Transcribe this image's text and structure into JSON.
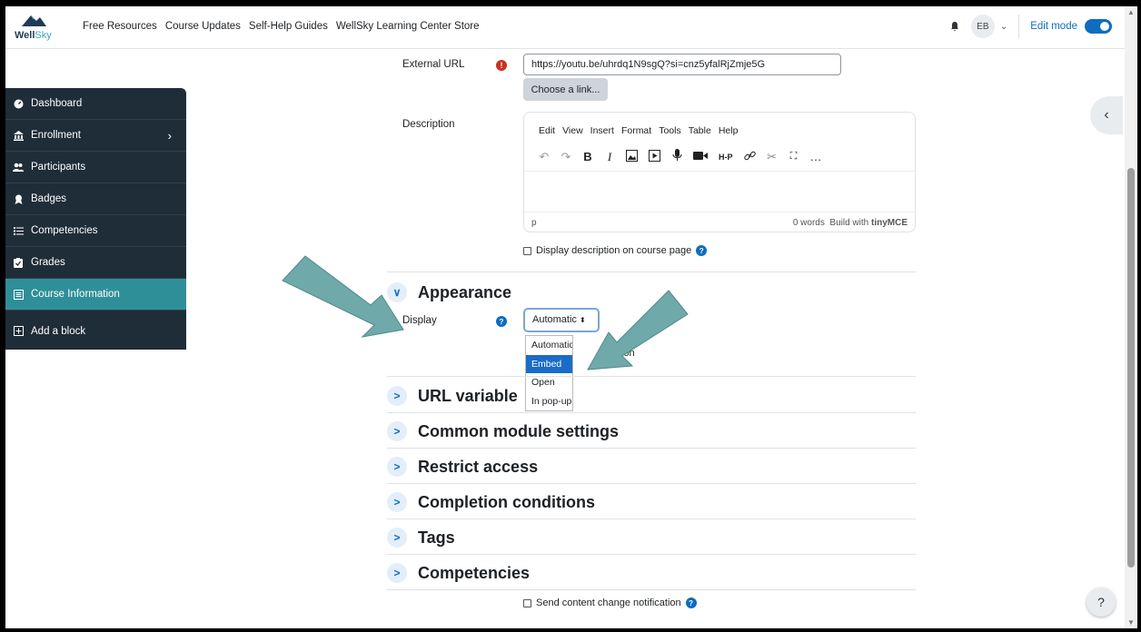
{
  "brand": {
    "name_part1": "Well",
    "name_part2": "Sky"
  },
  "nav": {
    "links": [
      "Free Resources",
      "Course Updates",
      "Self-Help Guides",
      "WellSky Learning Center Store"
    ],
    "user_initials": "EB",
    "edit_mode_label": "Edit mode"
  },
  "drawer": {
    "items": [
      {
        "label": "Dashboard",
        "icon": "dashboard-icon"
      },
      {
        "label": "Enrollment",
        "icon": "bank-icon"
      },
      {
        "label": "Participants",
        "icon": "users-icon"
      },
      {
        "label": "Badges",
        "icon": "badge-icon"
      },
      {
        "label": "Competencies",
        "icon": "list-icon"
      },
      {
        "label": "Grades",
        "icon": "grades-icon"
      },
      {
        "label": "Course Information",
        "icon": "info-box-icon"
      }
    ],
    "add_block": "Add a block"
  },
  "form": {
    "external_url_label": "External URL",
    "external_url_value": "https://youtu.be/uhrdq1N9sgQ?si=cnz5yfalRjZmje5G",
    "choose_link_button": "Choose a link...",
    "description_label": "Description",
    "editor_menus": [
      "Edit",
      "View",
      "Insert",
      "Format",
      "Tools",
      "Table",
      "Help"
    ],
    "editor_status_path": "p",
    "editor_word_count": "0 words",
    "editor_branding": "Build with",
    "editor_brand_name": "tinyMCE",
    "display_description_label": "Display description on course page",
    "appearance_heading": "Appearance",
    "display_label": "Display",
    "display_selected": "Automatic",
    "display_options": [
      "Automatic",
      "Embed",
      "Open",
      "In pop-up"
    ],
    "display_highlighted": "Embed",
    "partial_hidden_text": "ion",
    "sections": [
      "URL variables",
      "Common module settings",
      "Restrict access",
      "Completion conditions",
      "Tags",
      "Competencies"
    ],
    "url_variables_visible": "URL variable",
    "send_notification_label": "Send content change notification"
  },
  "colors": {
    "drawer_bg": "#1f2d39",
    "drawer_active": "#2f8f98",
    "primary": "#0f6cbf",
    "arrow": "#6fa9a9"
  }
}
